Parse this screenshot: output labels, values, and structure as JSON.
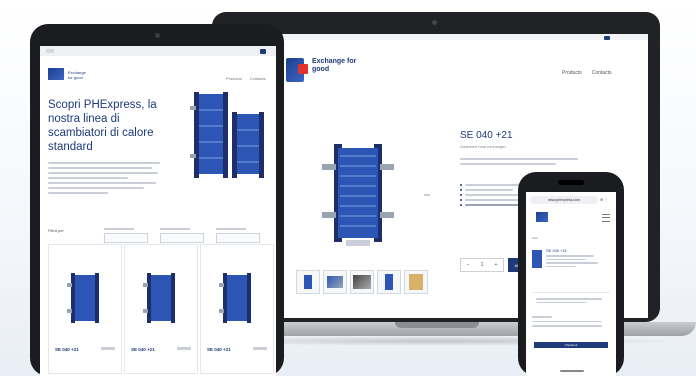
{
  "laptop": {
    "brand_tagline": "Exchange for good",
    "nav": [
      "Products",
      "Contacts"
    ],
    "product_title": "SE 040 +21",
    "product_subtitle": "Gasketed heat exchanger",
    "qty_minus": "−",
    "qty_value": "1",
    "qty_plus": "+",
    "add_label": "ADD TO CART"
  },
  "tablet": {
    "brand_text": "Exchange for good",
    "nav": [
      "Products",
      "Contacts"
    ],
    "headline": "Scopri PHExpress, la nostra linea di scambiatori di calore standard",
    "filter_label": "Filtra per",
    "cards": [
      {
        "name": "SE 040 +21"
      },
      {
        "name": "SE 040 +21"
      },
      {
        "name": "SE 040 +21"
      }
    ]
  },
  "phone": {
    "url": "www.phexpress.com",
    "icons": "⊕ ⋮",
    "cart_label": "Cart",
    "item_title": "SE 040 +21",
    "checkout_label": "Checkout"
  },
  "colors": {
    "brand_blue": "#1e3a78",
    "accent_red": "#e0332e",
    "device_dark": "#1a1c20"
  }
}
